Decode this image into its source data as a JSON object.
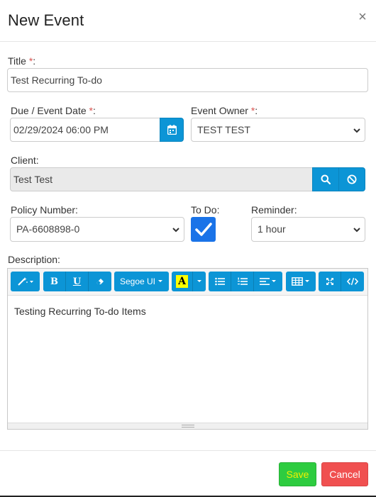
{
  "modal": {
    "title": "New Event",
    "close_symbol": "×"
  },
  "form": {
    "title_label": "Title",
    "title_value": "Test Recurring To-do",
    "due_date_label": "Due / Event Date",
    "due_date_value": "02/29/2024 06:00 PM",
    "event_owner_label": "Event Owner",
    "event_owner_value": "TEST TEST",
    "client_label": "Client:",
    "client_value": "Test Test",
    "policy_label": "Policy Number:",
    "policy_value": "PA-6608898-0",
    "todo_label": "To Do:",
    "todo_checked": true,
    "reminder_label": "Reminder:",
    "reminder_value": "1 hour",
    "description_label": "Description:",
    "required_marker": "*",
    "colon": ":"
  },
  "editor": {
    "font_name": "Segoe UI",
    "highlight_letter": "A",
    "bold_letter": "B",
    "underline_letter": "U",
    "content": "Testing Recurring To-do Items"
  },
  "footer": {
    "save_label": "Save",
    "cancel_label": "Cancel"
  },
  "colors": {
    "primary": "#0c95d6",
    "save": "#2ecc40",
    "cancel": "#f05050",
    "checkbox": "#1a73e8",
    "required": "#d9534f"
  }
}
